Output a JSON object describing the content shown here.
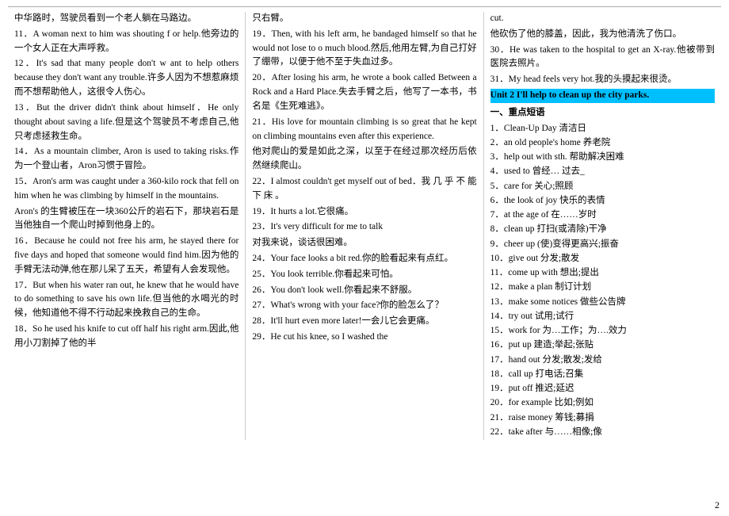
{
  "page_number": "2",
  "top_border": true,
  "columns": [
    {
      "id": "col1",
      "paragraphs": [
        "中华路时，驾驶员看到一个老人躺在马路边。",
        "11．A woman next to him was shouting f or help.他旁边的一个女人正在大声呼救。",
        "12．It's sad that many people don't w ant to help others because they don't want any trouble.许多人因为不想惹麻烦而不想帮助他人，这很令人伤心。",
        "13．But the driver didn't think about himself．He only thought about saving a life.但是这个驾驶员不考虑自己,他只考虑拯救生命。",
        "14．As a mountain climber, Aron is used to taking risks.作为一个登山者，Aron习惯于冒险。",
        "15．Aron's arm was caught under a 360-kilo rock that fell on him when he was climbing by himself in the mountains.",
        "Aron's 的生臂被压在一块360公斤的岩石下，那块岩石是当他独自一个爬山时掉到他身上的。",
        "16．Because he could not free his arm, he stayed there for five days and hoped that someone would find him.因为他的手臂无法动弹,他在那儿呆了五天，希望有人会发现他。",
        "17．But when his water ran out, he knew that he would have to do something to save his own life.但当他的水喝光的时候，他知道他不得不行动起来挽救自己的生命。",
        "18．So he used his knife to cut off half his right arm.因此,他用小刀割掉了他的半"
      ]
    },
    {
      "id": "col2",
      "paragraphs": [
        "只右臂。",
        "19．Then, with his left arm, he bandaged himself so that he would not lose to o much blood.然后,他用左臂,为自己打好了绷带，以便于他不至于失血过多。",
        "20．After losing his arm, he wrote a book called Between a Rock and a Hard Place.失去手臂之后，他写了一本书，书名是《生死难逃》。",
        "21．His love for mountain climbing is so great that he kept on climbing mountains even after this experience.",
        "他对爬山的爱是如此之深，以至于在经过那次经历后依然继续爬山。",
        "22．I almost couldn't get myself out of bed．我 几 乎 不 能 下 床 。",
        "19．It hurts a lot.它很痛。",
        "23．It's very difficult for me to talk",
        "对我来说，谈话很困难。",
        "24．Your face looks a bit red.你的脸看起来有点红。",
        "25．You look terrible.你看起来可怕。",
        "26．You don't look well.你看起来不舒服。",
        "27．What's wrong with your face?你的脸怎么了？",
        "28．It'll hurt even more later!一会儿它会更痛。",
        "29．He cut his knee, so I washed the"
      ]
    },
    {
      "id": "col3",
      "paragraphs_before_highlight": [
        "cut.",
        "他砍伤了他的膝盖，因此，我为他清洗了伤口。",
        "30．He was taken to the hospital to get an X-ray.他被带到医院去照片。",
        "31．My head feels very hot.我的头摸起来很烫。"
      ],
      "highlight_text": "Unit 2 I'll help to clean up the city parks.",
      "section_title": "一、重点短语",
      "vocab_items": [
        "1．Clean-Up Day 清洁日",
        "2．an old people's home 养老院",
        "3．help out with sth. 帮助解决困难",
        "4．used to 曾经… 过去_",
        "5．care for 关心;照顾",
        "6．the look of joy 快乐的表情",
        "7．at the age of 在……岁时",
        "8．clean up 打扫(或清除)干净",
        "9．cheer up (使)变得更高兴;振奋",
        "10．give out 分发;散发",
        "11．come up with 想出;提出",
        "12．make a plan 制订计划",
        "13．make some notices 做些公告牌",
        "14．try out 试用;试行",
        "15．work for 为…工作；为….效力",
        "16．put up 建造;举起;张贴",
        "17．hand out 分发;散发;发给",
        "18．call up 打电话;召集",
        "19．put off 推迟;延迟",
        "20．for example 比如;例如",
        "21．raise money 筹钱;募捐",
        "22．take after 与……相像;像"
      ]
    }
  ]
}
